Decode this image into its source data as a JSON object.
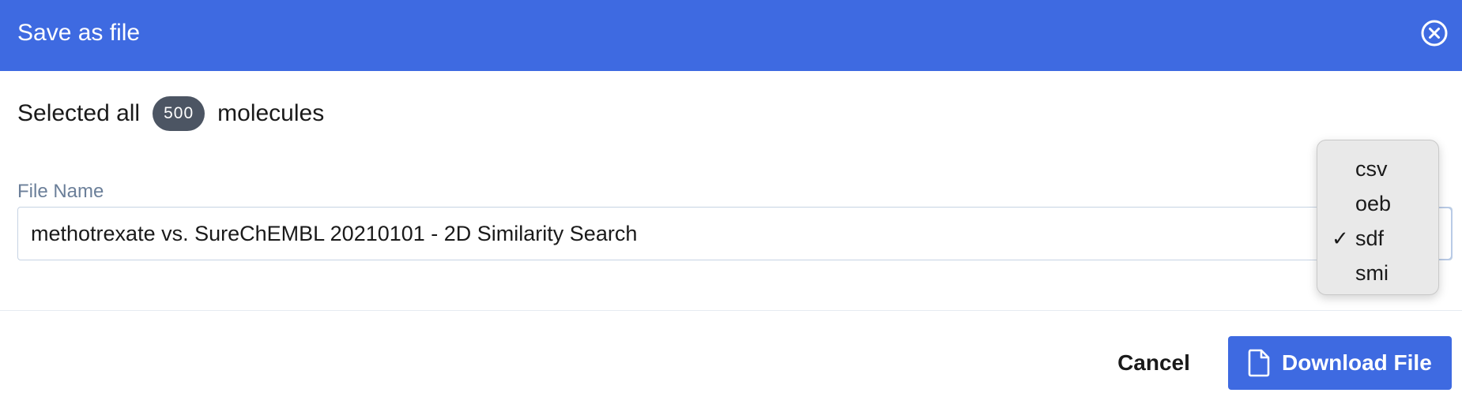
{
  "dialog": {
    "title": "Save as file",
    "close_icon": "close-circle-icon"
  },
  "selection": {
    "prefix": "Selected all",
    "count": "500",
    "suffix": "molecules"
  },
  "file_name": {
    "label": "File Name",
    "value": "methotrexate vs. SureChEMBL 20210101 - 2D Similarity Search"
  },
  "format_dropdown": {
    "options": [
      {
        "label": "csv",
        "checked": false
      },
      {
        "label": "oeb",
        "checked": false
      },
      {
        "label": "sdf",
        "checked": true
      },
      {
        "label": "smi",
        "checked": false
      }
    ],
    "selected": "sdf",
    "check_glyph": "✓"
  },
  "footer": {
    "cancel_label": "Cancel",
    "download_label": "Download File",
    "download_icon": "file-icon"
  },
  "colors": {
    "header_bg": "#3e6ae1",
    "primary_button": "#3e6ae1",
    "badge_bg": "#4c5563",
    "label_text": "#6b7f99"
  }
}
